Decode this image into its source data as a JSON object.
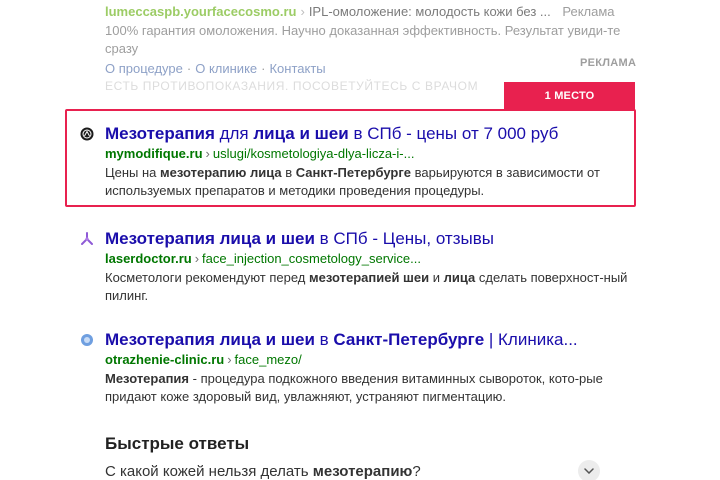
{
  "ad_top": {
    "domain": "lumeccaspb.yourfacecosmo.ru",
    "separator": "›",
    "text": "IPL-омоложение: молодость кожи без ...",
    "ad_label": "Реклама",
    "description": "100% гарантия омоложения. Научно доказанная эффективность. Результат увиди-те сразу",
    "sitelinks": [
      "О процедуре",
      "О клинике",
      "Контакты"
    ],
    "sitelink_separator": "·",
    "warning": "ЕСТЬ ПРОТИВОПОКАЗАНИЯ. ПОСОВЕТУЙТЕСЬ С ВРАЧОМ"
  },
  "ad_badge": "РЕКЛАМА",
  "rank_tab": "1 МЕСТО",
  "results": [
    {
      "favicon": "mymodifique-logo-icon",
      "title_parts": [
        "Мезотерапия",
        " для ",
        "лица и шеи",
        " в СПб - цены от 7 000 руб"
      ],
      "domain": "mymodifique.ru",
      "chevron": "›",
      "path": "uslugi/kosmetologiya-dlya-licza-i-...",
      "snippet_parts": [
        "Цены на ",
        "мезотерапию лица",
        " в ",
        "Санкт-Петербурге",
        " варьируются в зависимости от используемых препаратов и методики проведения процедуры."
      ]
    },
    {
      "favicon": "laserdoctor-logo-icon",
      "title_parts": [
        "Мезотерапия лица и шеи",
        " в СПб - Цены, отзывы"
      ],
      "domain": "laserdoctor.ru",
      "chevron": "›",
      "path": "face_injection_cosmetology_service...",
      "snippet_parts": [
        "Косметологи рекомендуют перед ",
        "мезотерапией шеи",
        " и ",
        "лица",
        " сделать поверхност-ный пилинг."
      ]
    },
    {
      "favicon": "otrazhenie-logo-icon",
      "title_parts": [
        "Мезотерапия лица и шеи",
        " в ",
        "Санкт-Петербурге",
        " | Клиника..."
      ],
      "domain": "otrazhenie-clinic.ru",
      "chevron": "›",
      "path": "face_mezo/",
      "snippet_parts": [
        "Мезотерапия",
        " - процедура подкожного введения витаминных сывороток, кото-рые придают коже здоровый вид, увлажняют, устраняют пигментацию."
      ]
    }
  ],
  "quick_answers": {
    "title": "Быстрые ответы",
    "question_parts": [
      "С какой кожей нельзя делать ",
      "мезотерапию",
      "?"
    ]
  },
  "colors": {
    "accent_red": "#e8214f",
    "link_blue": "#1a0dab",
    "url_green": "#007700"
  }
}
